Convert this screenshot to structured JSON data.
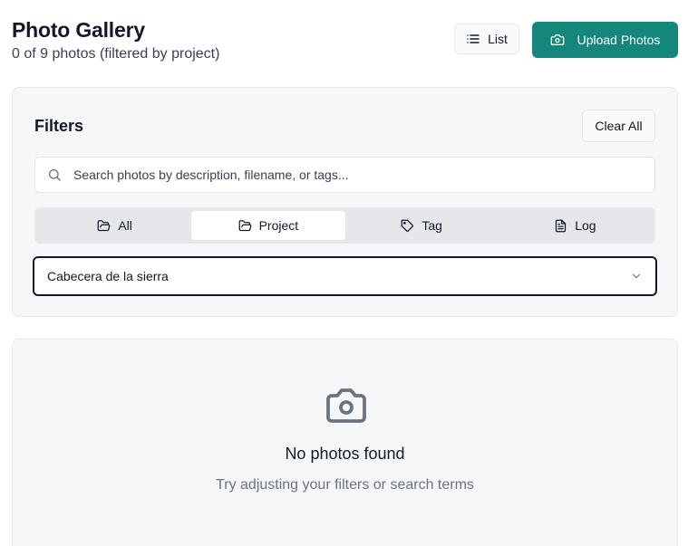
{
  "header": {
    "title": "Photo Gallery",
    "subtitle": "0 of 9 photos (filtered by project)",
    "list_button_label": "List",
    "list_icon": "list-icon",
    "upload_button_label": "Upload Photos",
    "upload_icon": "camera-icon"
  },
  "filters": {
    "title": "Filters",
    "clear_all_label": "Clear All",
    "search": {
      "placeholder": "Search photos by description, filename, or tags...",
      "value": "",
      "icon": "search-icon"
    },
    "tabs": [
      {
        "label": "All",
        "icon": "folder-icon",
        "active": false
      },
      {
        "label": "Project",
        "icon": "folder-icon",
        "active": true
      },
      {
        "label": "Tag",
        "icon": "tag-icon",
        "active": false
      },
      {
        "label": "Log",
        "icon": "document-icon",
        "active": false
      }
    ],
    "project_select": {
      "value": "Cabecera de la sierra",
      "icon": "chevron-down-icon"
    }
  },
  "empty_state": {
    "icon": "camera-icon",
    "title": "No photos found",
    "description": "Try adjusting your filters or search terms"
  },
  "colors": {
    "accent": "#14877a",
    "card_bg": "#f6f7f9",
    "border": "#e5e7eb",
    "muted_text": "#6b7280"
  }
}
